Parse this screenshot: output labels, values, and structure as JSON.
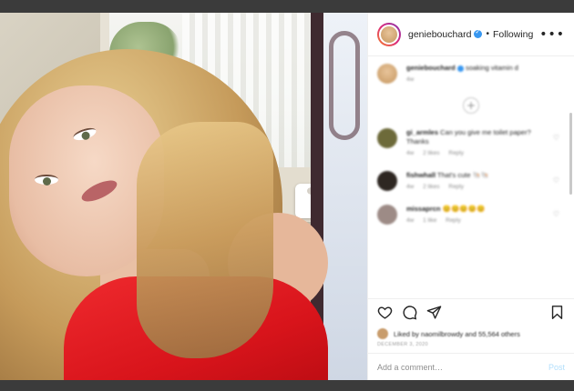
{
  "header": {
    "username": "geniebouchard",
    "separator": "•",
    "follow_status": "Following",
    "more_icon": "more-options-icon"
  },
  "caption": {
    "username": "geniebouchard",
    "text": "soaking vitamin d",
    "meta": "4w"
  },
  "load_more_icon": "plus-circle-icon",
  "comments": [
    {
      "username": "gi_armles",
      "text": "Can you give me toilet paper? Thanks",
      "time": "4w",
      "likes": "2 likes",
      "reply": "Reply",
      "avatar_color": "#6d6a3a"
    },
    {
      "username": "fishwhall",
      "text": "That's cute 🐚🐚",
      "time": "4w",
      "likes": "2 likes",
      "reply": "Reply",
      "avatar_color": "#2e2722"
    },
    {
      "username": "missaprcn",
      "text": "😊😊😊😊😊",
      "time": "4w",
      "likes": "1 like",
      "reply": "Reply",
      "avatar_color": "#9d8b86"
    }
  ],
  "actions": {
    "like_icon": "heart-icon",
    "comment_icon": "comment-icon",
    "share_icon": "share-icon",
    "save_icon": "bookmark-icon"
  },
  "likes_text": "Liked by naomilbrowdy and 55,564 others",
  "date": "DECEMBER 3, 2020",
  "add_comment": {
    "placeholder": "Add a comment…",
    "post_label": "Post"
  },
  "colors": {
    "verified": "#3897f0",
    "post_button_disabled": "#b2dffc",
    "shirt": "#d8141b"
  }
}
